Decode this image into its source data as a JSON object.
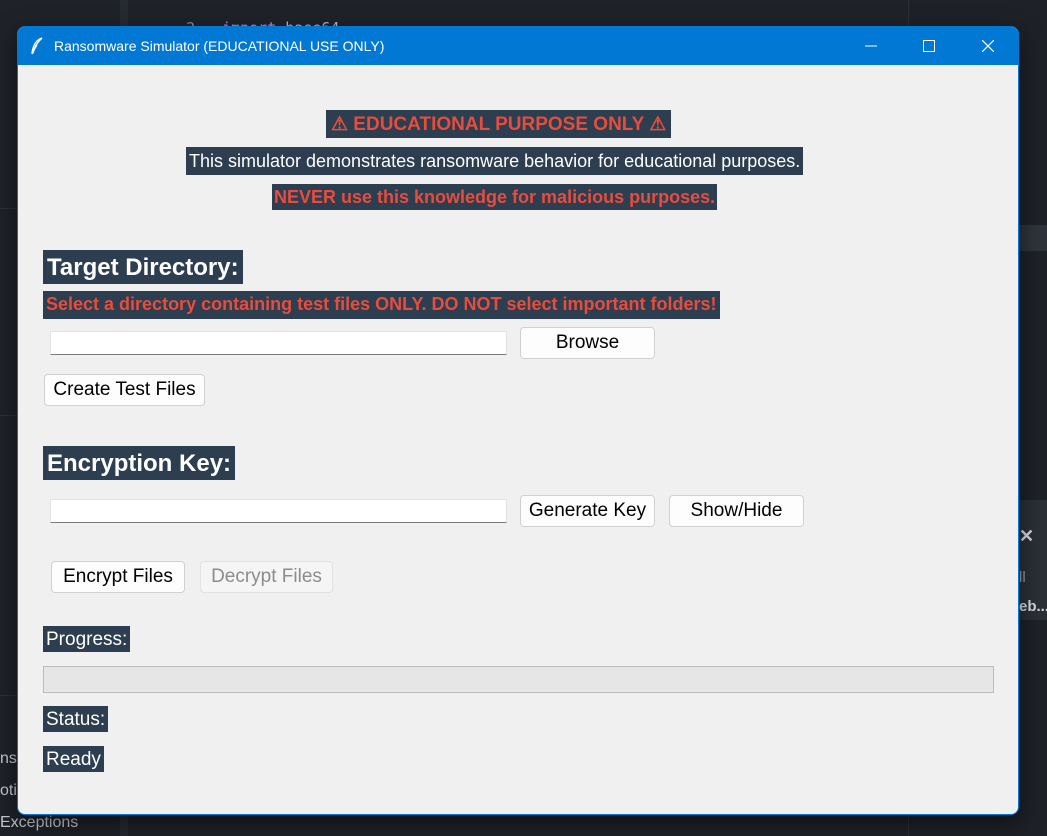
{
  "background": {
    "code_line_number": "2",
    "code_keyword": "import",
    "code_identifier": "base64",
    "right_text_1": "ll",
    "right_text_2": "eb...",
    "left_text_1": "ns",
    "left_text_2": "otio",
    "left_text_3": "Exceptions",
    "close_icon": "close-icon"
  },
  "window": {
    "title": "Ransomware Simulator (EDUCATIONAL USE ONLY)",
    "icon": "feather-icon",
    "controls": {
      "minimize_icon": "minimize-icon",
      "maximize_icon": "maximize-icon",
      "close_icon": "close-icon"
    }
  },
  "warning": {
    "title": "⚠ EDUCATIONAL PURPOSE ONLY ⚠",
    "description": "This simulator demonstrates ransomware behavior for educational purposes.",
    "never": "NEVER use this knowledge for malicious purposes."
  },
  "target": {
    "heading": "Target Directory:",
    "warning": "Select a directory containing test files ONLY. DO NOT select important folders!",
    "path_value": "",
    "browse_label": "Browse",
    "create_test_files_label": "Create Test Files"
  },
  "key": {
    "heading": "Encryption Key:",
    "key_value": "",
    "generate_label": "Generate Key",
    "show_hide_label": "Show/Hide"
  },
  "actions": {
    "encrypt_label": "Encrypt Files",
    "decrypt_label": "Decrypt Files"
  },
  "progress": {
    "label": "Progress:",
    "value": 0
  },
  "status": {
    "label": "Status:",
    "value": "Ready"
  },
  "colors": {
    "titlebar": "#0078d4",
    "label_bg": "#2c3e50",
    "warning_text": "#e74c3c",
    "window_bg": "#f0f0f0"
  }
}
